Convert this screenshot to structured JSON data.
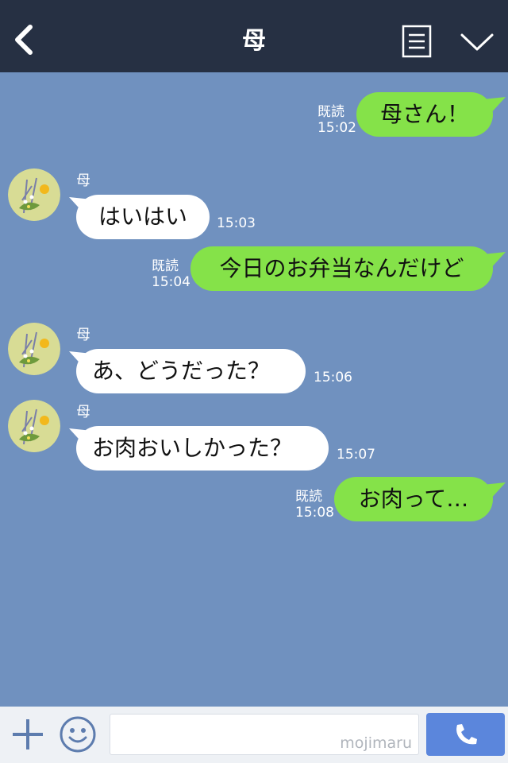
{
  "header": {
    "title": "母",
    "back_icon": "chevron-left-icon",
    "menu_icon": "list-icon",
    "collapse_icon": "chevron-down-icon"
  },
  "messages": [
    {
      "side": "me",
      "text": "母さん！",
      "read": "既読",
      "time": "15:02"
    },
    {
      "side": "them",
      "sender": "母",
      "text": "はいはい",
      "time": "15:03"
    },
    {
      "side": "me",
      "text": "今日のお弁当なんだけど",
      "read": "既読",
      "time": "15:04"
    },
    {
      "side": "them",
      "sender": "母",
      "text": "あ、どうだった？",
      "time": "15:06"
    },
    {
      "side": "them",
      "sender": "母",
      "text": "お肉おいしかった？",
      "time": "15:07"
    },
    {
      "side": "me",
      "text": "お肉って…",
      "read": "既読",
      "time": "15:08"
    }
  ],
  "composer": {
    "watermark": "mojimaru",
    "plus_icon": "plus-icon",
    "emoji_icon": "smiley-icon",
    "call_icon": "phone-icon"
  },
  "colors": {
    "header_bg": "#263043",
    "chat_bg": "#7091bf",
    "my_bubble": "#85e249",
    "their_bubble": "#ffffff",
    "call_button": "#5b86dc"
  }
}
